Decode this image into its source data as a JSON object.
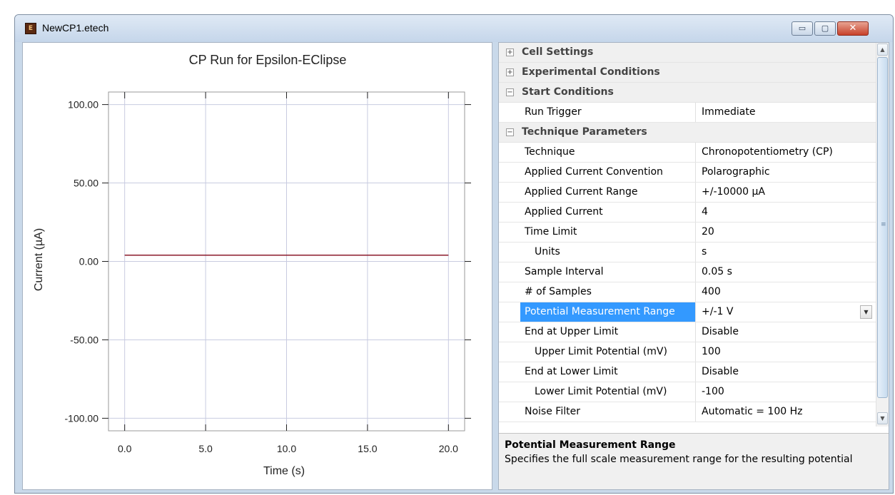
{
  "window": {
    "title": "NewCP1.etech",
    "icon": "etech-app-icon"
  },
  "window_controls": {
    "minimize": "▭",
    "maximize": "▢",
    "close": "✕"
  },
  "chart_data": {
    "type": "line",
    "title": "CP Run for Epsilon-EClipse",
    "xlabel": "Time (s)",
    "ylabel": "Current (µA)",
    "xlim": [
      -1,
      21
    ],
    "ylim": [
      -108,
      108
    ],
    "x_ticks": [
      "0.0",
      "5.0",
      "10.0",
      "15.0",
      "20.0"
    ],
    "x_tick_values": [
      0,
      5,
      10,
      15,
      20
    ],
    "y_ticks": [
      "100.00",
      "50.00",
      "0.00",
      "-50.00",
      "-100.00"
    ],
    "y_tick_values": [
      100,
      50,
      0,
      -50,
      -100
    ],
    "grid": true,
    "series": [
      {
        "x": [
          0,
          20
        ],
        "values": [
          4,
          4
        ],
        "color": "#8b1a2b"
      }
    ]
  },
  "properties": {
    "categories": [
      {
        "label": "Cell Settings",
        "expander": "+"
      },
      {
        "label": "Experimental Conditions",
        "expander": "+"
      },
      {
        "label": "Start Conditions",
        "expander": "−"
      },
      {
        "label": "Technique Parameters",
        "expander": "−"
      }
    ],
    "rows": [
      {
        "name": "Run Trigger",
        "value": "Immediate"
      },
      {
        "name": "Technique",
        "value": "Chronopotentiometry (CP)"
      },
      {
        "name": "Applied Current Convention",
        "value": "Polarographic"
      },
      {
        "name": "Applied Current Range",
        "value": "+/-10000 µA"
      },
      {
        "name": "Applied Current",
        "value": "4"
      },
      {
        "name": "Time Limit",
        "value": "20"
      },
      {
        "name": "Units",
        "value": "s"
      },
      {
        "name": "Sample Interval",
        "value": "0.05 s"
      },
      {
        "name": "# of Samples",
        "value": "400"
      },
      {
        "name": "Potential Measurement Range",
        "value": "+/-1 V"
      },
      {
        "name": "End at Upper Limit",
        "value": "Disable"
      },
      {
        "name": "Upper Limit Potential (mV)",
        "value": "100"
      },
      {
        "name": "End at Lower Limit",
        "value": "Disable"
      },
      {
        "name": "Lower Limit Potential (mV)",
        "value": "-100"
      },
      {
        "name": "Noise Filter",
        "value": "Automatic = 100 Hz"
      }
    ],
    "selected": "Potential Measurement Range",
    "dropdown_icon": "▼"
  },
  "scrollbar": {
    "up": "▲",
    "down": "▼"
  },
  "description": {
    "title": "Potential Measurement Range",
    "text": "Specifies the full scale measurement range for the resulting potential"
  }
}
